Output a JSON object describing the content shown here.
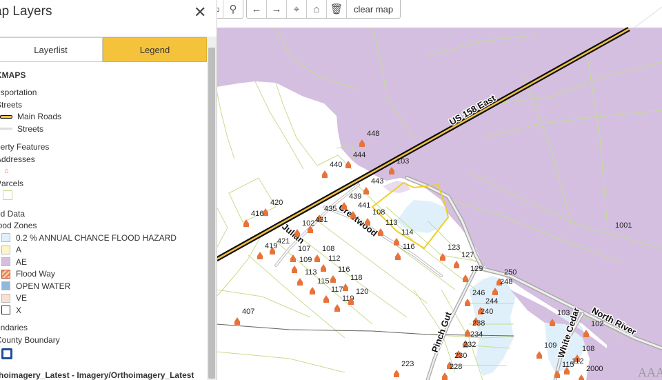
{
  "panel": {
    "title": "ap Layers",
    "close_icon": "close-icon",
    "tabs": [
      {
        "label": "Layerlist",
        "active": false
      },
      {
        "label": "Legend",
        "active": true
      }
    ]
  },
  "legend": {
    "heading": "KMAPS",
    "transportation": "nsportation",
    "streets_group": "Streets",
    "main_roads": "Main Roads",
    "streets": "Streets",
    "property": "perty Features",
    "addresses": "Addresses",
    "parcels": "Parcels",
    "flood_data": "od Data",
    "flood_zones": "lood Zones",
    "zones": [
      {
        "label": "0.2 % ANNUAL CHANCE FLOOD HAZARD",
        "color": "#dff0fb"
      },
      {
        "label": "A",
        "color": "#fdf5c8"
      },
      {
        "label": "AE",
        "color": "#d4bfe0"
      },
      {
        "label": "Flood Way",
        "color": "#e98a5a"
      },
      {
        "label": "OPEN WATER",
        "color": "#8fb8dd"
      },
      {
        "label": "VE",
        "color": "#fbe0d2"
      },
      {
        "label": "X",
        "color": "#ffffff"
      }
    ],
    "boundaries": "undaries",
    "county_boundary": "County Boundary",
    "orthoimagery": "thoimagery_Latest - Imagery/Orthoimagery_Latest"
  },
  "toolbar": {
    "clear_label": "clear map",
    "icons": [
      "box-icon",
      "person-icon",
      "back-arrow-icon",
      "forward-arrow-icon",
      "pin-icon",
      "home-icon",
      "trash-icon"
    ]
  },
  "map": {
    "road_labels": {
      "us158": "US 158 East",
      "julian": "Julian",
      "crestwood": "Crestwood",
      "pinch_gut": "Pinch Gut",
      "white_cedar": "White Cedar",
      "north_river": "North River"
    },
    "addresses": [
      "448",
      "444",
      "440",
      "103",
      "443",
      "439",
      "441",
      "435",
      "420",
      "416",
      "431",
      "102",
      "108",
      "113",
      "114",
      "116",
      "421",
      "419",
      "107",
      "108",
      "109",
      "112",
      "116",
      "113",
      "118",
      "115",
      "117",
      "119",
      "120",
      "123",
      "127",
      "129",
      "250",
      "248",
      "246",
      "244",
      "240",
      "238",
      "234",
      "232",
      "230",
      "228",
      "223",
      "407",
      "103",
      "102",
      "109",
      "108",
      "112",
      "115",
      "2000",
      "1001"
    ],
    "watermark": "AAA"
  },
  "colors": {
    "flood_ae": "#d4bfe0",
    "parcel_line": "#c5dd8e",
    "accent_tab": "#f5c33b",
    "address_marker": "#e8733a",
    "selected_parcel": "#f0d020"
  }
}
